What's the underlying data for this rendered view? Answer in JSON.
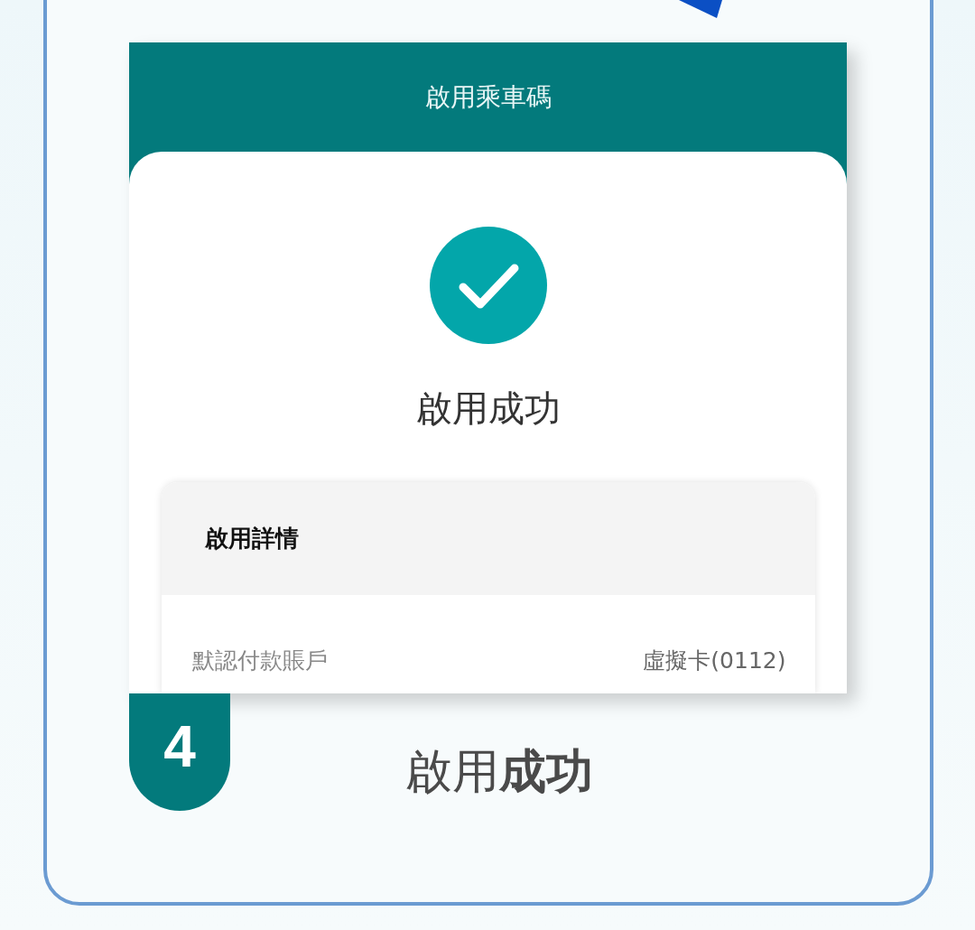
{
  "header": {
    "title": "啟用乘車碼"
  },
  "result": {
    "kind": "success",
    "message": "啟用成功"
  },
  "details": {
    "title": "啟用詳情",
    "rows": [
      {
        "label": "默認付款賬戶",
        "value": "虛擬卡(0112)"
      }
    ]
  },
  "step": {
    "number": "4",
    "caption": "啟用**成功**"
  }
}
